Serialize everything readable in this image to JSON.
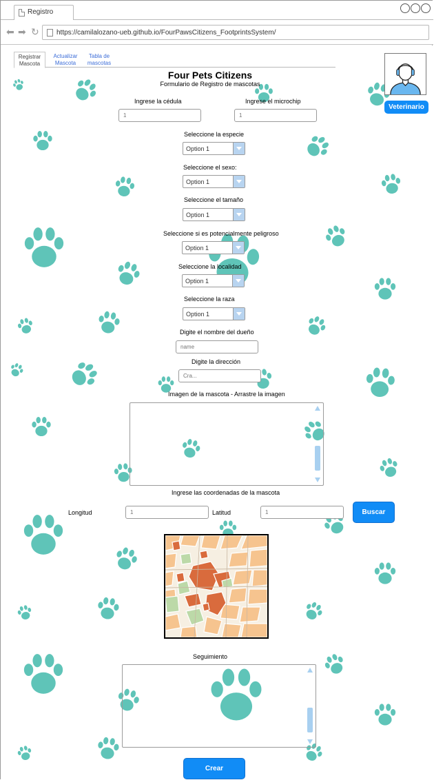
{
  "browser": {
    "tab_title": "Registro",
    "url": "https://camilalozano-ueb.github.io/FourPawsCitizens_FootprintsSystem/"
  },
  "tabs": [
    {
      "label_line1": "Registrar",
      "label_line2": "Mascota"
    },
    {
      "label_line1": "Actualizar",
      "label_line2": "Mascota"
    },
    {
      "label_line1": "Tabla de",
      "label_line2": "mascotas"
    }
  ],
  "header": {
    "title": "Four Pets Citizens",
    "subtitle": "Formulario de Registro de mascotas"
  },
  "user": {
    "role": "Veterinario"
  },
  "form": {
    "cedula": {
      "label": "Ingrese la cédula",
      "placeholder": "1"
    },
    "microchip": {
      "label": "Ingrese el microchip",
      "placeholder": "1"
    },
    "especie": {
      "label": "Seleccione la especie",
      "value": "Option 1"
    },
    "sexo": {
      "label": "Seleccione el sexo:",
      "value": "Option 1"
    },
    "tamano": {
      "label": "Seleccione el tamaño",
      "value": "Option 1"
    },
    "peligroso": {
      "label": "Seleccione si es potencialmente peligroso",
      "value": "Option 1"
    },
    "localidad": {
      "label": "Seleccione la localidad",
      "value": "Option 1"
    },
    "raza": {
      "label": "Seleccione la raza",
      "value": "Option 1"
    },
    "dueno": {
      "label": "Digite el nombre del dueño",
      "placeholder": "name"
    },
    "direccion": {
      "label": "Digite la dirección",
      "placeholder": "Cra..."
    },
    "imagen": {
      "label": "Imagen de la mascota - Arrastre la imagen"
    },
    "coordenadas": {
      "label": "Ingrese las coordenadas de la mascota",
      "longitud_label": "Longitud",
      "longitud_placeholder": "1",
      "latitud_label": "Latitud",
      "latitud_placeholder": "1",
      "search_button": "Buscar"
    },
    "seguimiento": {
      "label": "Seguimiento"
    },
    "submit": "Crear"
  },
  "colors": {
    "paw": "#5fc4b8",
    "button": "#118cf6",
    "link": "#3c6dd8"
  }
}
